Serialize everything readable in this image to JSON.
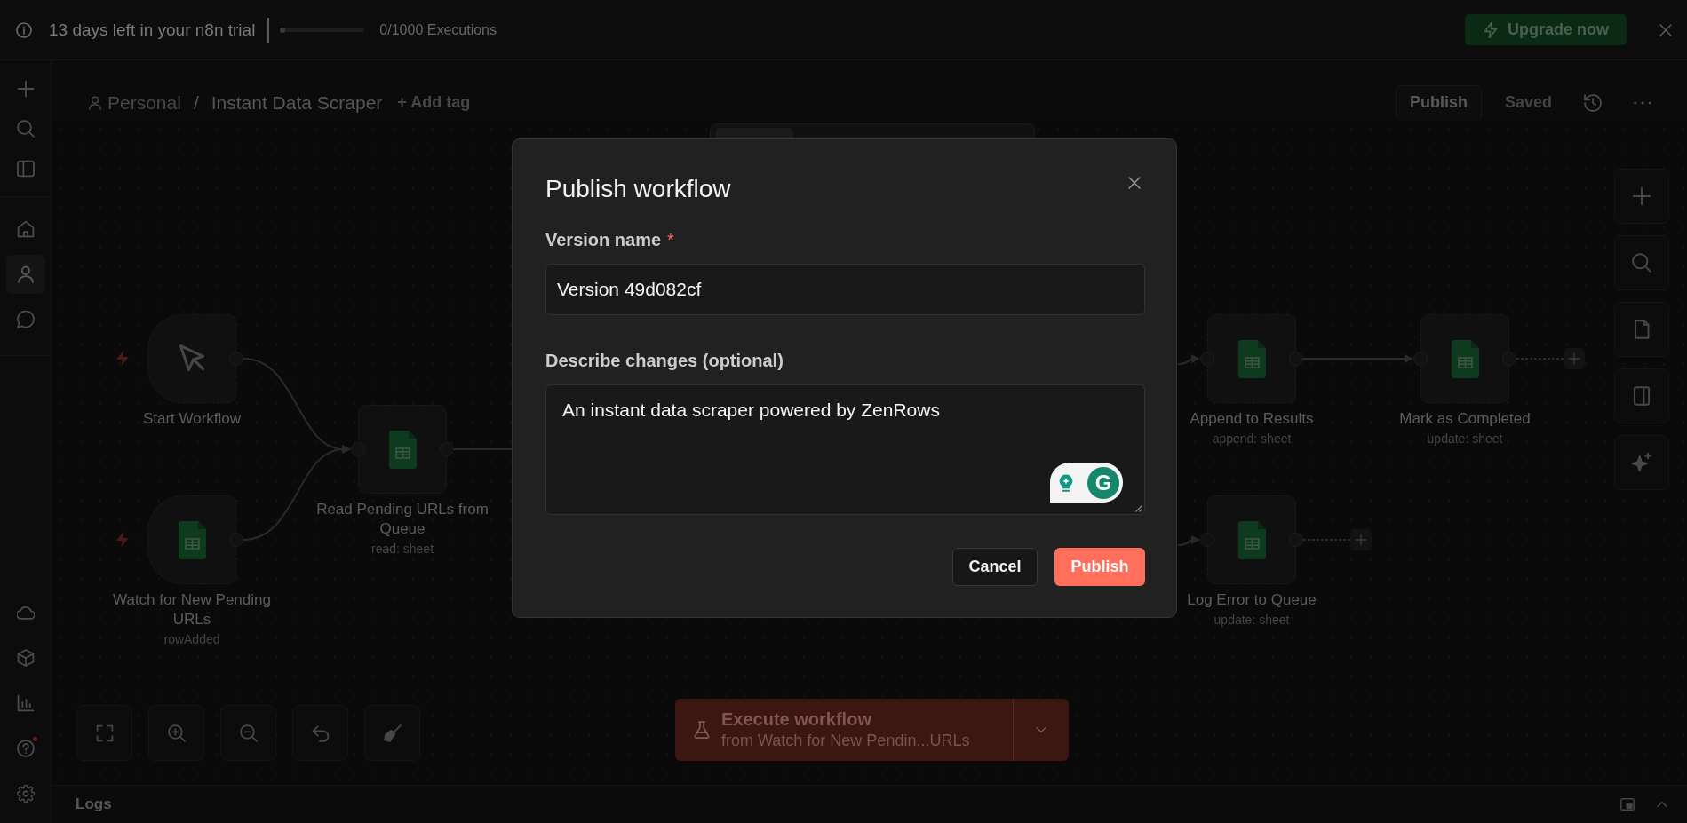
{
  "trial_banner": {
    "message": "13 days left in your n8n trial",
    "executions": {
      "level": 0,
      "reading": "0/1000 Executions"
    },
    "upgrade_button": "Upgrade now"
  },
  "sidebar": {
    "nav_items": [
      {
        "selected": false
      },
      {
        "selected": true
      },
      {
        "selected": false
      }
    ],
    "bottom_items": [
      {
        "notification": false
      },
      {
        "notification": false
      },
      {
        "notification": false
      },
      {
        "notification": true
      },
      {
        "notification": false
      }
    ]
  },
  "header": {
    "project": "Personal",
    "separator": "/",
    "workflow_name": "Instant Data Scraper",
    "add_tag": "+ Add tag",
    "publish_button": "Publish",
    "save_status": "Saved"
  },
  "canvas": {
    "nodes": [
      {
        "kind": "manual_trigger",
        "title": "Start Workflow",
        "add_button": false
      },
      {
        "kind": "sheet_trigger",
        "title": "Watch for New Pending URLs",
        "subtitle": "rowAdded",
        "add_button": false
      },
      {
        "kind": "sheet",
        "title": "Read Pending URLs from Queue",
        "subtitle": "read: sheet",
        "add_button": false
      },
      {
        "kind": "sheet",
        "title": "Append to Results",
        "subtitle": "append: sheet",
        "add_button": false
      },
      {
        "kind": "sheet",
        "title": "Mark as Completed",
        "subtitle": "update: sheet",
        "add_button": true
      },
      {
        "kind": "sheet",
        "title": "Log Error to Queue",
        "subtitle": "update: sheet",
        "add_button": true
      }
    ],
    "execute_button": {
      "label": "Execute workflow",
      "source": "from Watch for New Pendin...URLs"
    }
  },
  "logs_panel": {
    "title": "Logs"
  },
  "modal": {
    "title": "Publish workflow",
    "fields": [
      {
        "kind": "input",
        "label": "Version name",
        "required_mark": "*",
        "value": "Version 49d082cf"
      },
      {
        "kind": "textarea",
        "label": "Describe changes (optional)",
        "value": "An instant data scraper powered by ZenRows"
      }
    ],
    "assistant_badge": {
      "letter": "G"
    },
    "buttons": [
      {
        "kind": "secondary",
        "label": "Cancel"
      },
      {
        "kind": "primary",
        "label": "Publish"
      }
    ]
  }
}
